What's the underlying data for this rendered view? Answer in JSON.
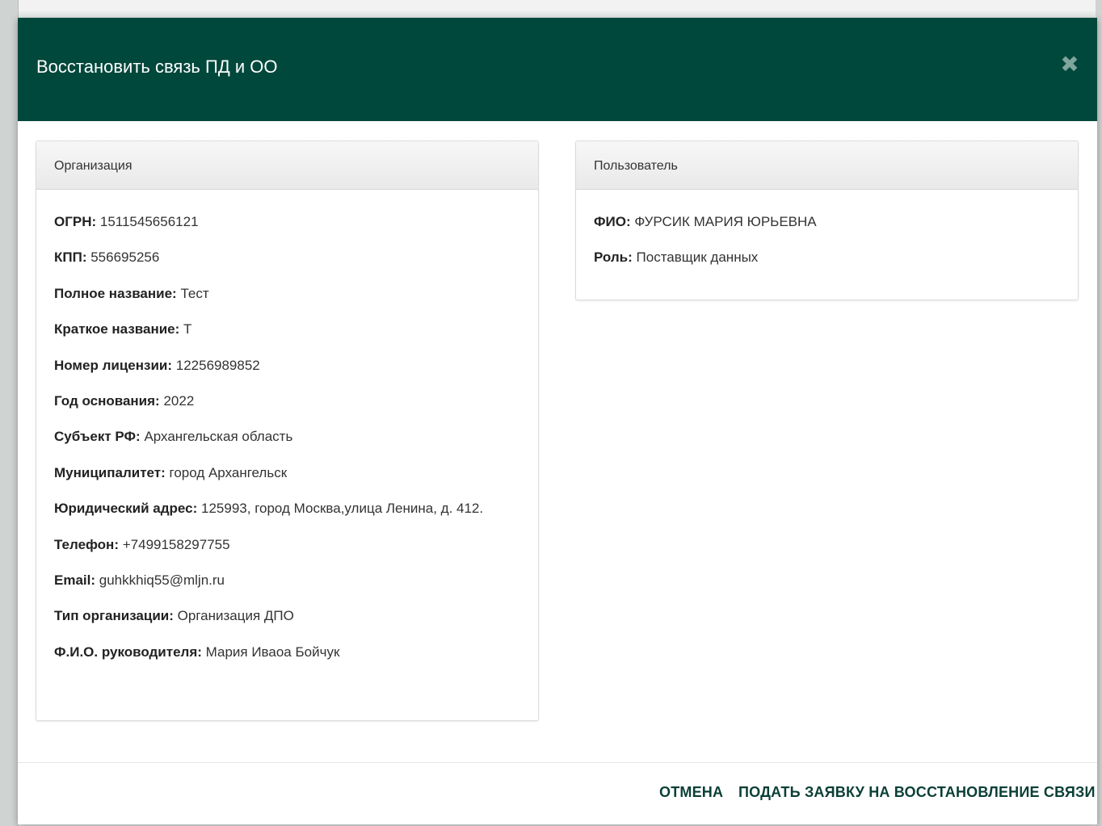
{
  "modal": {
    "title": "Восстановить связь ПД и ОО",
    "close_icon": "close-icon",
    "colors": {
      "header_bg": "#00483b",
      "accent_text": "#0a3f36"
    }
  },
  "organization": {
    "heading": "Организация",
    "fields": [
      {
        "label": "ОГРН:",
        "value": "1511545656121"
      },
      {
        "label": "КПП:",
        "value": "556695256"
      },
      {
        "label": "Полное название:",
        "value": "Тест"
      },
      {
        "label": "Краткое название:",
        "value": "Т"
      },
      {
        "label": "Номер лицензии:",
        "value": "12256989852"
      },
      {
        "label": "Год основания:",
        "value": "2022"
      },
      {
        "label": "Субъект РФ:",
        "value": "Архангельская область"
      },
      {
        "label": "Муниципалитет:",
        "value": "город Архангельск"
      },
      {
        "label": "Юридический адрес:",
        "value": "125993, город Москва,улица Ленина, д. 412."
      },
      {
        "label": "Телефон:",
        "value": "+7499158297755"
      },
      {
        "label": "Email:",
        "value": "guhkkhiq55@mljn.ru"
      },
      {
        "label": "Тип организации:",
        "value": "Организация ДПО"
      },
      {
        "label": "Ф.И.О. руководителя:",
        "value": "Мария Иваоа Бойчук"
      }
    ]
  },
  "user": {
    "heading": "Пользователь",
    "fields": [
      {
        "label": "ФИО:",
        "value": "ФУРСИК МАРИЯ ЮРЬЕВНА"
      },
      {
        "label": "Роль:",
        "value": "Поставщик данных"
      }
    ]
  },
  "footer": {
    "cancel_label": "ОТМЕНА",
    "submit_label": "ПОДАТЬ ЗАЯВКУ НА ВОССТАНОВЛЕНИЕ СВЯЗИ"
  }
}
